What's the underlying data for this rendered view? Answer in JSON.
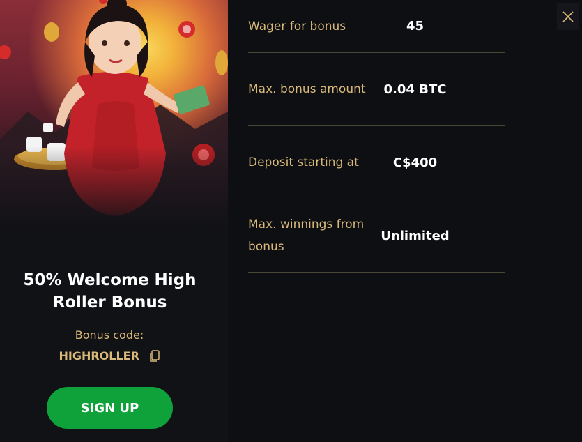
{
  "promo": {
    "title": "50% Welcome High Roller Bonus",
    "code_label": "Bonus code:",
    "code_value": "HIGHROLLER",
    "signup_label": "SIGN UP"
  },
  "details": [
    {
      "label": "Wager for bonus",
      "value": "45"
    },
    {
      "label": "Max. bonus amount",
      "value": "0.04 BTC"
    },
    {
      "label": "Deposit starting at",
      "value": "C$400"
    },
    {
      "label": "Max. winnings from bonus",
      "value": "Unlimited"
    }
  ],
  "icons": {
    "close": "close-icon",
    "copy": "copy-icon"
  },
  "colors": {
    "background": "#0e0f12",
    "gold_text": "#d9b97a",
    "signup_green": "#0fa13a",
    "divider": "#4a4636"
  }
}
